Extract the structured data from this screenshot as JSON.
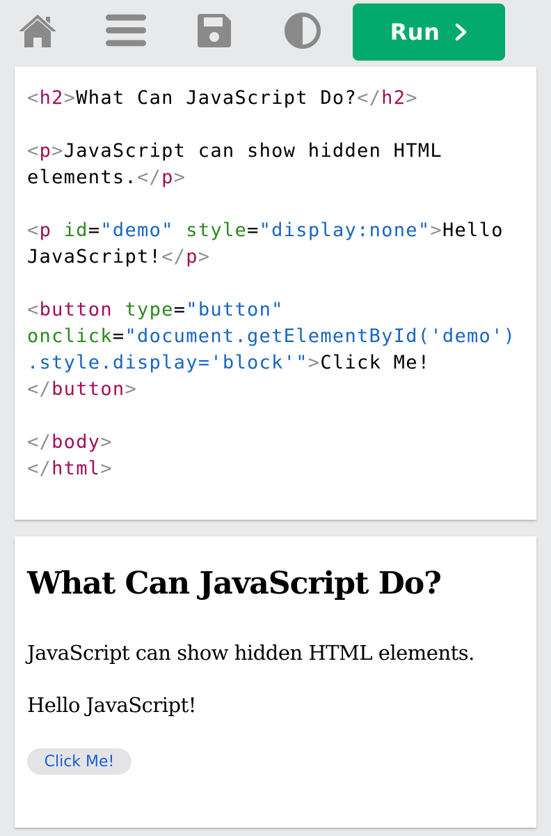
{
  "toolbar": {
    "icons": [
      "home-icon",
      "menu-icon",
      "save-icon",
      "theme-icon"
    ],
    "run_label": "Run",
    "run_icon": "chevron-right-icon",
    "icon_color": "#8a8a8a",
    "run_color": "#04aa6d"
  },
  "code": {
    "colors": {
      "bracket": "#8f8f8f",
      "tag": "#a0105a",
      "attribute": "#2a8a1e",
      "value": "#1866c0",
      "text": "#000000"
    },
    "lines": [
      [
        [
          "br",
          "<"
        ],
        [
          "tag",
          "h2"
        ],
        [
          "br",
          ">"
        ],
        [
          "text",
          "What Can JavaScript Do?"
        ],
        [
          "br",
          "</"
        ],
        [
          "tag",
          "h2"
        ],
        [
          "br",
          ">"
        ]
      ],
      [],
      [
        [
          "br",
          "<"
        ],
        [
          "tag",
          "p"
        ],
        [
          "br",
          ">"
        ],
        [
          "text",
          "JavaScript can show hidden HTML"
        ]
      ],
      [
        [
          "text",
          "elements."
        ],
        [
          "br",
          "</"
        ],
        [
          "tag",
          "p"
        ],
        [
          "br",
          ">"
        ]
      ],
      [],
      [
        [
          "br",
          "<"
        ],
        [
          "tag",
          "p"
        ],
        [
          "text",
          " "
        ],
        [
          "attr",
          "id"
        ],
        [
          "eq",
          "="
        ],
        [
          "val",
          "\"demo\""
        ],
        [
          "text",
          " "
        ],
        [
          "attr",
          "style"
        ],
        [
          "eq",
          "="
        ],
        [
          "val",
          "\"display:none\""
        ],
        [
          "br",
          ">"
        ],
        [
          "text",
          "Hello"
        ]
      ],
      [
        [
          "text",
          "JavaScript!"
        ],
        [
          "br",
          "</"
        ],
        [
          "tag",
          "p"
        ],
        [
          "br",
          ">"
        ]
      ],
      [],
      [
        [
          "br",
          "<"
        ],
        [
          "tag",
          "button"
        ],
        [
          "text",
          " "
        ],
        [
          "attr",
          "type"
        ],
        [
          "eq",
          "="
        ],
        [
          "val",
          "\"button\""
        ]
      ],
      [
        [
          "attr",
          "onclick"
        ],
        [
          "eq",
          "="
        ],
        [
          "val",
          "\"document.getElementById('demo')"
        ]
      ],
      [
        [
          "val",
          ".style.display='block'\""
        ],
        [
          "br",
          ">"
        ],
        [
          "text",
          "Click Me!"
        ]
      ],
      [
        [
          "br",
          "</"
        ],
        [
          "tag",
          "button"
        ],
        [
          "br",
          ">"
        ]
      ],
      [],
      [
        [
          "br",
          "</"
        ],
        [
          "tag",
          "body"
        ],
        [
          "br",
          ">"
        ]
      ],
      [
        [
          "br",
          "</"
        ],
        [
          "tag",
          "html"
        ],
        [
          "br",
          ">"
        ]
      ]
    ]
  },
  "result": {
    "heading": "What Can JavaScript Do?",
    "paragraph1": "JavaScript can show hidden HTML elements.",
    "paragraph2": "Hello JavaScript!",
    "button_label": "Click Me!"
  }
}
